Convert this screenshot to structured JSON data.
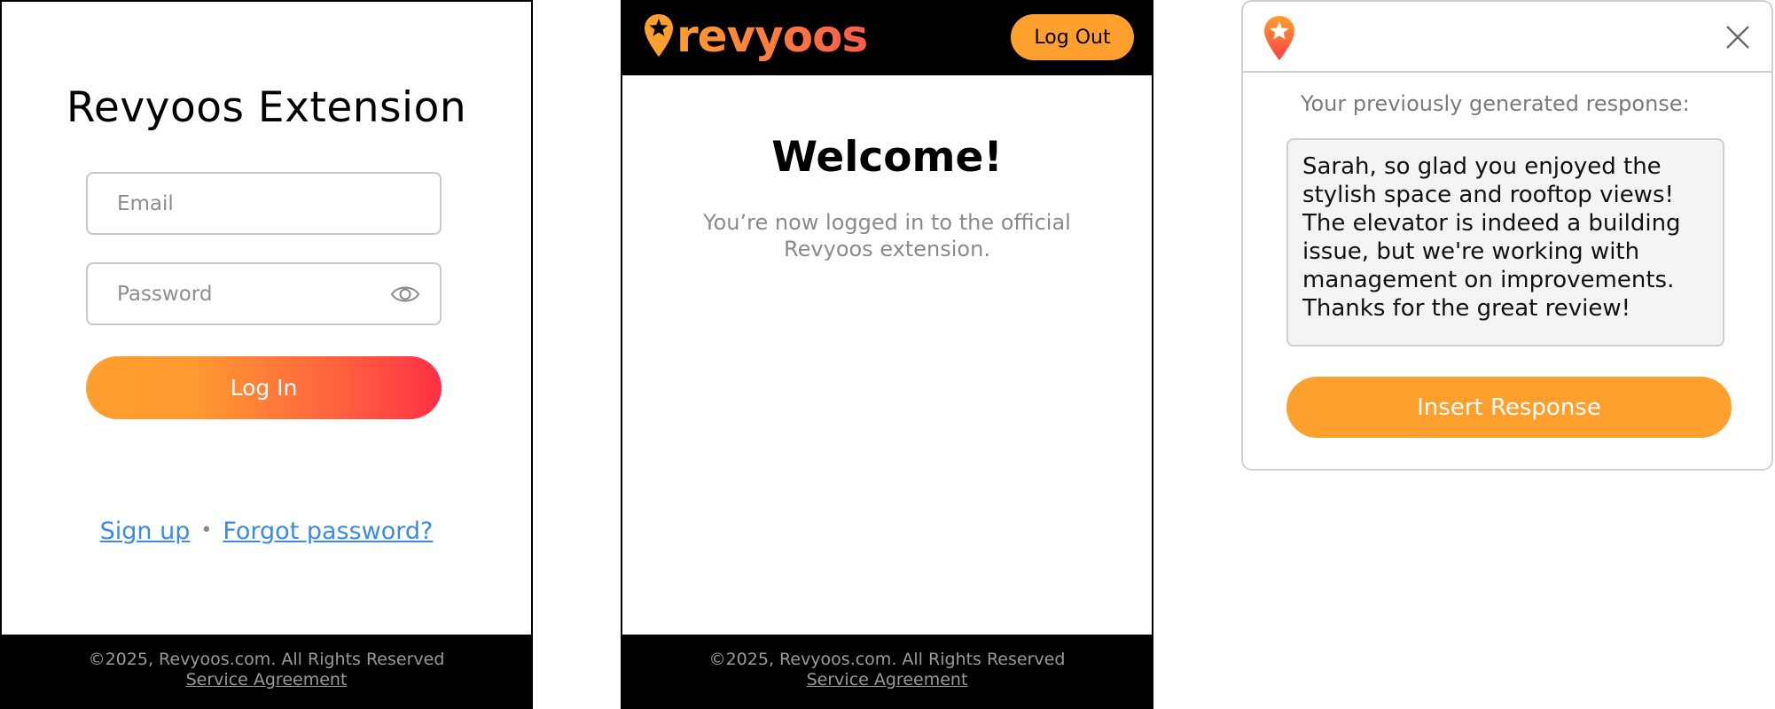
{
  "login": {
    "title": "Revyoos Extension",
    "email_placeholder": "Email",
    "password_placeholder": "Password",
    "login_label": "Log In",
    "signup_label": "Sign up",
    "separator": "•",
    "forgot_label": "Forgot password?"
  },
  "welcome": {
    "brand": "revyoos",
    "logout_label": "Log Out",
    "title": "Welcome!",
    "message": "You’re now logged in to the official Revyoos extension."
  },
  "footer": {
    "copyright": "©2025, Revyoos.com. All Rights Reserved",
    "agreement": "Service Agreement"
  },
  "response": {
    "label": "Your previously generated response:",
    "text": "Sarah, so glad you enjoyed the stylish space and rooftop views! The elevator is indeed a building issue, but we're working with management on improvements. Thanks for the great review!",
    "insert_label": "Insert Response"
  },
  "icons": {
    "eye": "eye-icon",
    "pin": "location-pin-star-icon",
    "close": "close-icon"
  },
  "colors": {
    "brand_orange": "#ff9f2e",
    "brand_red": "#ff2f45",
    "link_blue": "#3a8ae6",
    "footer_bg": "#000000"
  }
}
